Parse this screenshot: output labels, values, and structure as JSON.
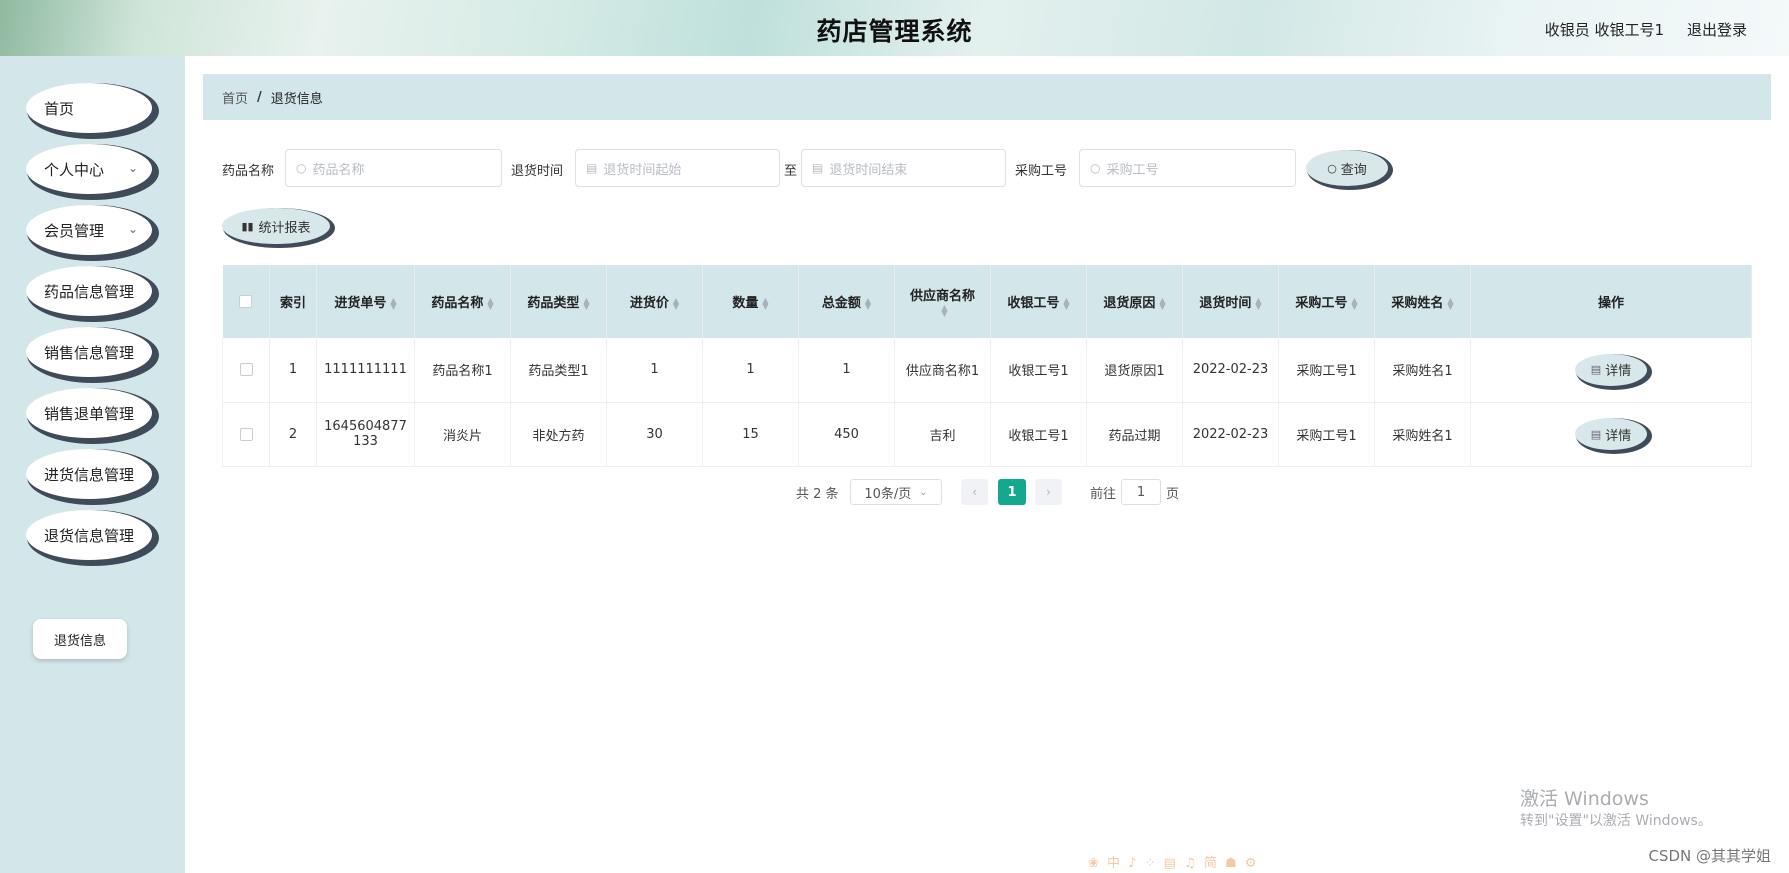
{
  "header": {
    "title": "药店管理系统",
    "user_info": "收银员 收银工号1",
    "logout": "退出登录"
  },
  "sidebar": {
    "items": [
      {
        "label": "首页"
      },
      {
        "label": "个人中心"
      },
      {
        "label": "会员管理"
      },
      {
        "label": "药品信息管理"
      },
      {
        "label": "销售信息管理"
      },
      {
        "label": "销售退单管理"
      },
      {
        "label": "进货信息管理"
      },
      {
        "label": "退货信息管理"
      }
    ],
    "submenu": {
      "label": "退货信息"
    }
  },
  "breadcrumb": {
    "home": "首页",
    "separator": "/",
    "current": "退货信息"
  },
  "filters": {
    "drug_name_label": "药品名称",
    "drug_name_placeholder": "药品名称",
    "return_time_label": "退货时间",
    "start_placeholder": "退货时间起始",
    "to_label": "至",
    "end_placeholder": "退货时间结束",
    "purchase_id_label": "采购工号",
    "purchase_id_placeholder": "采购工号",
    "query_button": "查询",
    "report_button": "统计报表"
  },
  "table": {
    "headers": [
      "索引",
      "进货单号",
      "药品名称",
      "药品类型",
      "进货价",
      "数量",
      "总金额",
      "供应商名称",
      "收银工号",
      "退货原因",
      "退货时间",
      "采购工号",
      "采购姓名",
      "操作"
    ],
    "rows": [
      {
        "index": "1",
        "order_no": "1111111111",
        "drug_name": "药品名称1",
        "drug_type": "药品类型1",
        "price": "1",
        "qty": "1",
        "total": "1",
        "supplier": "供应商名称1",
        "cashier": "收银工号1",
        "reason": "退货原因1",
        "time": "2022-02-23",
        "purchase_id": "采购工号1",
        "purchase_name": "采购姓名1",
        "action": "详情"
      },
      {
        "index": "2",
        "order_no": "1645604877133",
        "drug_name": "消炎片",
        "drug_type": "非处方药",
        "price": "30",
        "qty": "15",
        "total": "450",
        "supplier": "吉利",
        "cashier": "收银工号1",
        "reason": "药品过期",
        "time": "2022-02-23",
        "purchase_id": "采购工号1",
        "purchase_name": "采购姓名1",
        "action": "详情"
      }
    ]
  },
  "pagination": {
    "total": "共 2 条",
    "page_size": "10条/页",
    "current_page": "1",
    "goto_label": "前往",
    "goto_value": "1",
    "page_suffix": "页"
  },
  "overlay": {
    "watermark_title": "激活 Windows",
    "watermark_sub": "转到\"设置\"以激活 Windows。",
    "csdn": "CSDN @其其学姐"
  },
  "colors": {
    "accent": "#12a98e",
    "panel": "#d3e6ea",
    "shadow": "#3f4b58"
  }
}
